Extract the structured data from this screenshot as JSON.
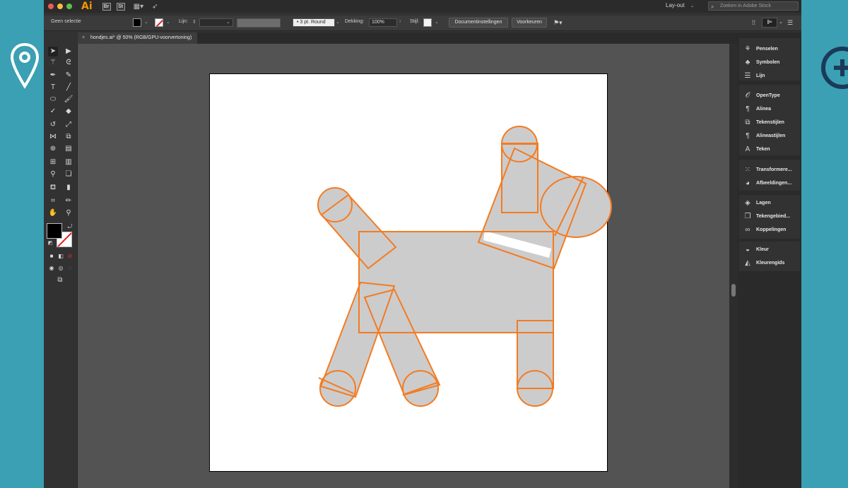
{
  "menubar": {
    "app_logo": "Ai",
    "badge_br": "Br",
    "badge_st": "St",
    "workspace": "Lay-out",
    "stock_search_placeholder": "Zoeken in Adobe Stock"
  },
  "controlbar": {
    "selection_label": "Geen selectie",
    "stroke_label": "Lijn:",
    "brush_value": "3 pt. Round",
    "opacity_label": "Dekking:",
    "opacity_value": "100%",
    "style_label": "Stijl:",
    "document_settings_button": "Documentinstellingen",
    "preferences_button": "Voorkeuren"
  },
  "document_tab": {
    "title": "hondjes.ai* @ 50% (RGB/GPU-voorvertoning)",
    "close_glyph": "×"
  },
  "right_panels": [
    {
      "label": "Penselen",
      "icon": "brushes-icon"
    },
    {
      "label": "Symbolen",
      "icon": "symbols-icon"
    },
    {
      "label": "Lijn",
      "icon": "stroke-icon"
    },
    {
      "label": "OpenType",
      "icon": "opentype-icon"
    },
    {
      "label": "Alinea",
      "icon": "paragraph-icon"
    },
    {
      "label": "Tekenstijlen",
      "icon": "character-styles-icon"
    },
    {
      "label": "Alineastijlen",
      "icon": "paragraph-styles-icon"
    },
    {
      "label": "Teken",
      "icon": "character-icon"
    },
    {
      "label": "Transformere...",
      "icon": "transform-icon"
    },
    {
      "label": "Afbeeldingen...",
      "icon": "image-trace-icon"
    },
    {
      "label": "Lagen",
      "icon": "layers-icon"
    },
    {
      "label": "Tekengebied...",
      "icon": "artboards-icon"
    },
    {
      "label": "Koppelingen",
      "icon": "links-icon"
    },
    {
      "label": "Kleur",
      "icon": "color-icon"
    },
    {
      "label": "Kleurengids",
      "icon": "color-guide-icon"
    }
  ],
  "colors": {
    "accent_orange": "#f47b20",
    "shape_fill": "#cccccc",
    "background_teal": "#3ba0b3",
    "app_dark": "#323232"
  }
}
